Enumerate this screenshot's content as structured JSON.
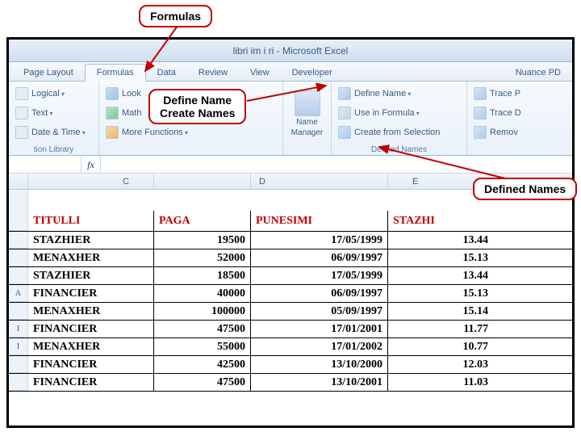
{
  "callouts": {
    "c1": "Formulas",
    "c2a": "Define Name",
    "c2b": "Create Names",
    "c3": "Defined Names"
  },
  "title": "libri im i ri  -  Microsoft Excel",
  "tabs": {
    "page_layout": "Page Layout",
    "formulas": "Formulas",
    "data": "Data",
    "review": "Review",
    "view": "View",
    "developer": "Developer",
    "nuance": "Nuance PD"
  },
  "ribbon": {
    "logical": "Logical",
    "text": "Text",
    "datetime": "Date & Time",
    "library_caption": "tion Library",
    "lookup": "Look",
    "math": "Math",
    "more": "More Functions",
    "name_mgr1": "Name",
    "name_mgr2": "Manager",
    "define_name": "Define Name",
    "use_in_formula": "Use in Formula",
    "create_from_selection": "Create from Selection",
    "defined_names_caption": "Defined Names",
    "trace_p": "Trace P",
    "trace_d": "Trace D",
    "remove": "Remov"
  },
  "fx": "fx",
  "columns": {
    "c": "C",
    "d": "D",
    "e": "E"
  },
  "headers": {
    "b": "TITULLI",
    "c": "PAGA",
    "d": "PUNESIMI",
    "e": "STAZHI"
  },
  "rows": [
    {
      "a": "",
      "b": "STAZHIER",
      "c": "19500",
      "d": "17/05/1999",
      "e": "13.44"
    },
    {
      "a": "",
      "b": "MENAXHER",
      "c": "52000",
      "d": "06/09/1997",
      "e": "15.13"
    },
    {
      "a": "",
      "b": "STAZHIER",
      "c": "18500",
      "d": "17/05/1999",
      "e": "13.44"
    },
    {
      "a": "A",
      "b": "FINANCIER",
      "c": "40000",
      "d": "06/09/1997",
      "e": "15.13"
    },
    {
      "a": "",
      "b": "MENAXHER",
      "c": "100000",
      "d": "05/09/1997",
      "e": "15.14"
    },
    {
      "a": "I",
      "b": "FINANCIER",
      "c": "47500",
      "d": "17/01/2001",
      "e": "11.77"
    },
    {
      "a": "I",
      "b": "MENAXHER",
      "c": "55000",
      "d": "17/01/2002",
      "e": "10.77"
    },
    {
      "a": "",
      "b": "FINANCIER",
      "c": "42500",
      "d": "13/10/2000",
      "e": "12.03"
    },
    {
      "a": "",
      "b": "FINANCIER",
      "c": "47500",
      "d": "13/10/2001",
      "e": "11.03"
    }
  ]
}
